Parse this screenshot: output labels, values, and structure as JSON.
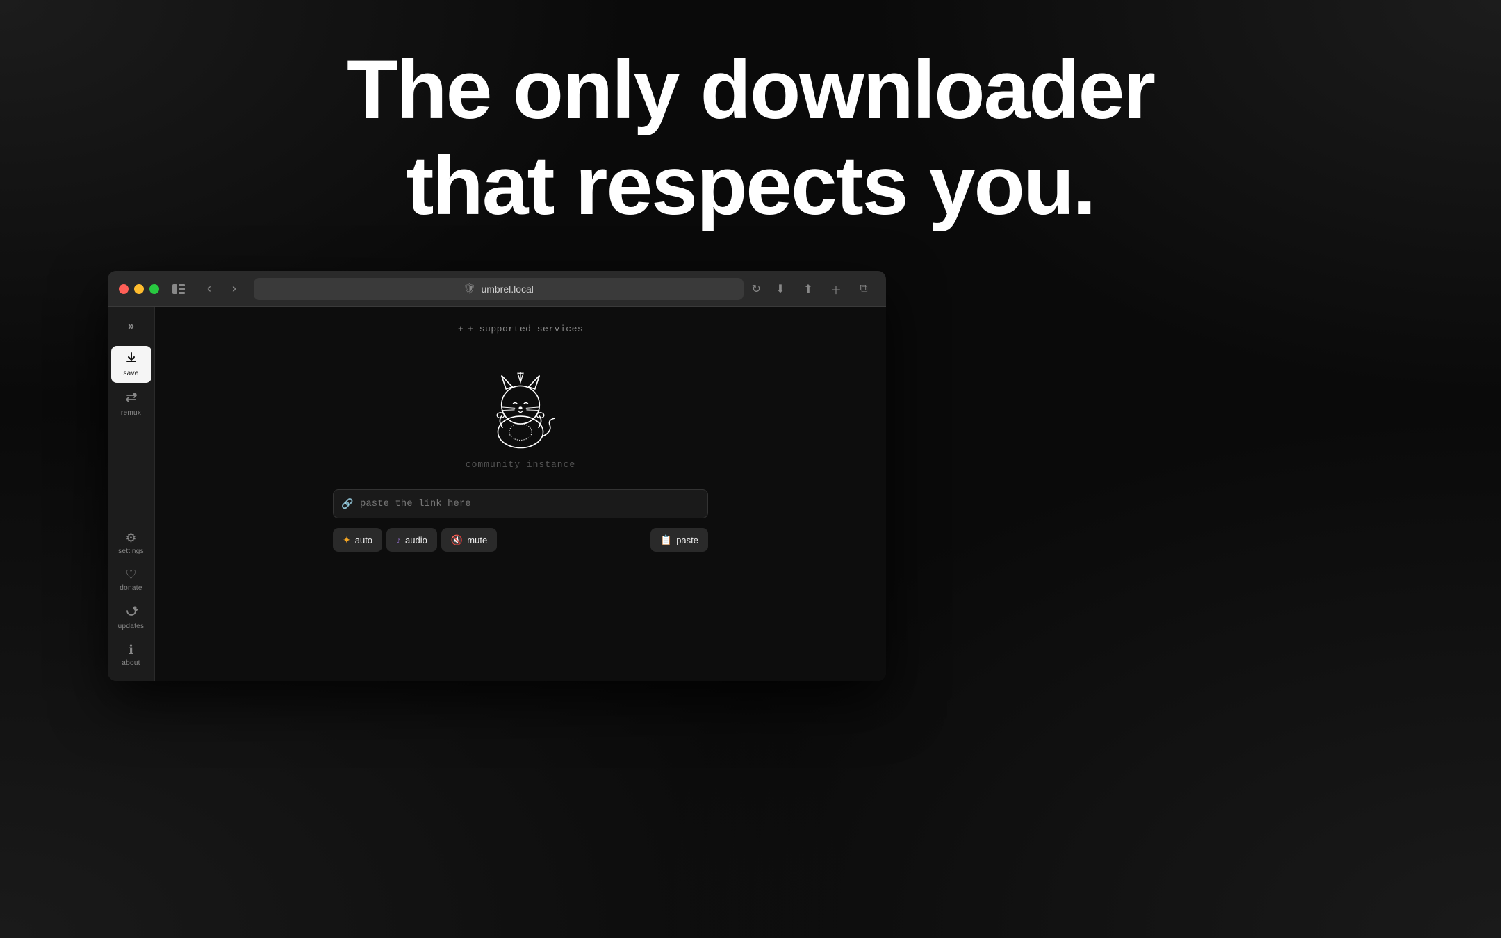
{
  "hero": {
    "line1": "The only downloader",
    "line2": "that respects you."
  },
  "browser": {
    "url": "umbrel.local",
    "traffic_lights": {
      "red": "#ff5f57",
      "yellow": "#febc2e",
      "green": "#28c840"
    }
  },
  "sidebar": {
    "expand_icon": "≫",
    "items": [
      {
        "id": "save",
        "label": "save",
        "icon": "↓",
        "active": true
      },
      {
        "id": "remux",
        "label": "remux",
        "icon": "⇄",
        "active": false
      }
    ],
    "bottom_items": [
      {
        "id": "settings",
        "label": "settings",
        "icon": "⚙"
      },
      {
        "id": "donate",
        "label": "donate",
        "icon": "♡"
      },
      {
        "id": "updates",
        "label": "updates",
        "icon": "↻"
      },
      {
        "id": "about",
        "label": "about",
        "icon": "ℹ"
      }
    ]
  },
  "main": {
    "supported_services_label": "+ supported services",
    "community_label": "community instance",
    "url_input_placeholder": "paste the link here",
    "buttons": {
      "auto": "auto",
      "audio": "audio",
      "mute": "mute",
      "paste": "paste"
    }
  }
}
